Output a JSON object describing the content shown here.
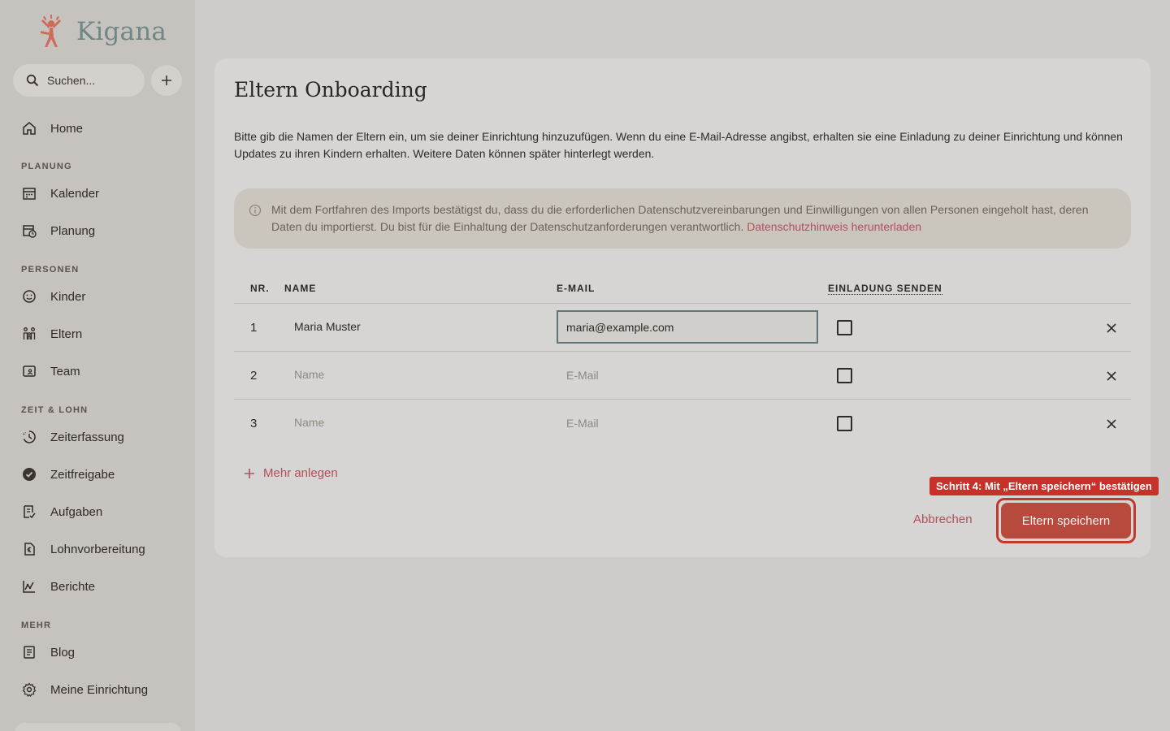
{
  "app": {
    "name": "Kigana",
    "brand_color": "#d06a5a",
    "accent": "#b0505a"
  },
  "sidebar": {
    "search": {
      "placeholder": "Suchen..."
    },
    "home": "Home",
    "sections": [
      {
        "label": "PLANUNG",
        "items": [
          {
            "label": "Kalender",
            "icon": "calendar-icon"
          },
          {
            "label": "Planung",
            "icon": "calendar-clock-icon"
          }
        ]
      },
      {
        "label": "PERSONEN",
        "items": [
          {
            "label": "Kinder",
            "icon": "smiley-icon"
          },
          {
            "label": "Eltern",
            "icon": "family-icon"
          },
          {
            "label": "Team",
            "icon": "id-card-icon"
          }
        ]
      },
      {
        "label": "ZEIT & LOHN",
        "items": [
          {
            "label": "Zeiterfassung",
            "icon": "clock-history-icon"
          },
          {
            "label": "Zeitfreigabe",
            "icon": "check-circle-icon"
          },
          {
            "label": "Aufgaben",
            "icon": "task-icon"
          },
          {
            "label": "Lohnvorbereitung",
            "icon": "payroll-icon"
          },
          {
            "label": "Berichte",
            "icon": "chart-icon"
          }
        ]
      },
      {
        "label": "MEHR",
        "items": [
          {
            "label": "Blog",
            "icon": "newspaper-icon"
          },
          {
            "label": "Meine Einrichtung",
            "icon": "gear-icon"
          }
        ]
      }
    ]
  },
  "main": {
    "title": "Eltern Onboarding",
    "description": "Bitte gib die Namen der Eltern ein, um sie deiner Einrichtung hinzuzufügen. Wenn du eine E-Mail-Adresse angibst, erhalten sie eine Einladung zu deiner Einrichtung und können Updates zu ihren Kindern erhalten. Weitere Daten können später hinterlegt werden.",
    "notice": {
      "text": "Mit dem Fortfahren des Imports bestätigst du, dass du die erforderlichen Datenschutzvereinbarungen und Einwilligungen von allen Personen eingeholt hast, deren Daten du importierst. Du bist für die Einhaltung der Datenschutzanforderungen verantwortlich.",
      "link": "Datenschutzhinweis herunterladen"
    },
    "table": {
      "columns": {
        "nr": "NR.",
        "name": "NAME",
        "email": "E-MAIL",
        "invite": "EINLADUNG SENDEN"
      },
      "rows": [
        {
          "nr": "1",
          "name": "Maria Muster",
          "email": "maria@example.com",
          "invite": false
        },
        {
          "nr": "2",
          "name": "",
          "email": "",
          "invite": false
        },
        {
          "nr": "3",
          "name": "",
          "email": "",
          "invite": false
        }
      ],
      "name_placeholder": "Name",
      "email_placeholder": "E-Mail"
    },
    "add_more": "Mehr anlegen",
    "cancel": "Abbrechen",
    "save": "Eltern speichern",
    "tooltip": "Schritt 4: Mit „Eltern speichern“ bestätigen"
  }
}
